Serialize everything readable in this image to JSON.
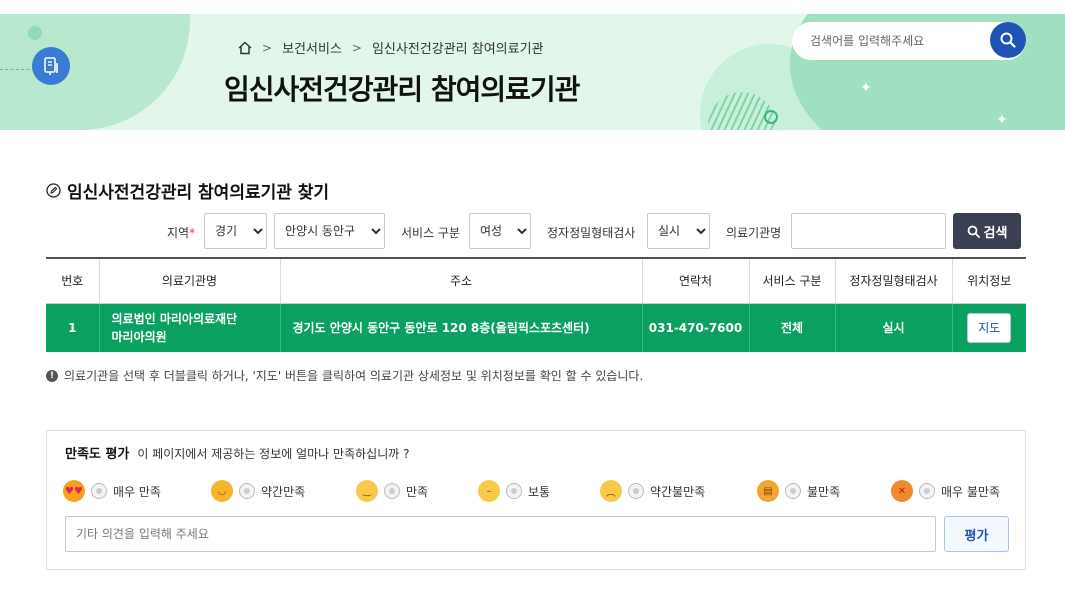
{
  "header": {
    "breadcrumb": [
      "보건서비스",
      "임신사전건강관리 참여의료기관"
    ],
    "title": "임신사전건강관리 참여의료기관",
    "search_placeholder": "검색어를 입력해주세요"
  },
  "section": {
    "title": "임신사전건강관리 참여의료기관 찾기"
  },
  "filters": {
    "region_label": "지역",
    "region_required": "*",
    "region_value": "경기",
    "district_value": "안양시 동안구",
    "service_label": "서비스 구분",
    "service_value": "여성",
    "test_label": "정자정밀형태검사",
    "test_value": "실시",
    "name_label": "의료기관명",
    "name_value": "",
    "search_label": "검색"
  },
  "table": {
    "headers": [
      "번호",
      "의료기관명",
      "주소",
      "연락처",
      "서비스 구분",
      "정자정밀형태검사",
      "위치정보"
    ],
    "rows": [
      {
        "no": "1",
        "name_line1": "의료법인 마리아의료재단",
        "name_line2": "마리아의원",
        "address": "경기도 안양시 동안구 동안로 120 8층(올림픽스포츠센터)",
        "phone": "031-470-7600",
        "service": "전체",
        "test": "실시",
        "map_label": "지도"
      }
    ]
  },
  "notice": "의료기관을 선택 후 더블클릭 하거나, '지도' 버튼을 클릭하여 의료기관 상세정보 및 위치정보를 확인 할 수 있습니다.",
  "survey": {
    "title": "만족도 평가",
    "question": "이 페이지에서 제공하는 정보에 얼마나 만족하십니까 ?",
    "options": [
      "매우 만족",
      "약간만족",
      "만족",
      "보통",
      "약간불만족",
      "불만족",
      "매우 불만족"
    ],
    "comment_placeholder": "기타 의견을 입력해 주세요",
    "submit_label": "평가"
  },
  "colors": {
    "accent_green": "#0aa060",
    "accent_blue": "#1f54b4",
    "dark_button": "#3b3f52"
  }
}
